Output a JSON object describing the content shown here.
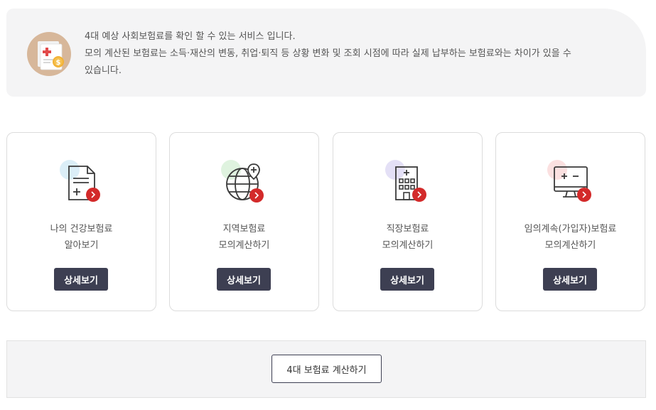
{
  "notice": {
    "line1": "4대 예상 사회보험료를 확인 할 수 있는 서비스 입니다.",
    "line2": "모의 계산된 보험료는 소득·재산의 변동, 취업·퇴직 등 상황 변화 및 조회 시점에 따라 실제 납부하는 보험료와는 차이가 있을 수",
    "line3": "있습니다.",
    "icon": "insurance-document-coin-icon"
  },
  "cards": [
    {
      "title_line1": "나의 건강보험료",
      "title_line2": "알아보기",
      "button": "상세보기",
      "icon": "document-plus-icon",
      "accent": "#dbeef7"
    },
    {
      "title_line1": "지역보험료",
      "title_line2": "모의계산하기",
      "button": "상세보기",
      "icon": "globe-pin-icon",
      "accent": "#dff3df"
    },
    {
      "title_line1": "직장보험료",
      "title_line2": "모의계산하기",
      "button": "상세보기",
      "icon": "building-icon",
      "accent": "#e4e0f6"
    },
    {
      "title_line1": "임의계속(가입자)보험료",
      "title_line2": "모의계산하기",
      "button": "상세보기",
      "icon": "calculator-monitor-icon",
      "accent": "#fbe0e0"
    }
  ],
  "bottom": {
    "calc_button": "4대 보험료 계산하기"
  },
  "colors": {
    "button_dark": "#3d3f52",
    "badge_red": "#d32a2a",
    "panel_bg": "#f4f4f5"
  }
}
